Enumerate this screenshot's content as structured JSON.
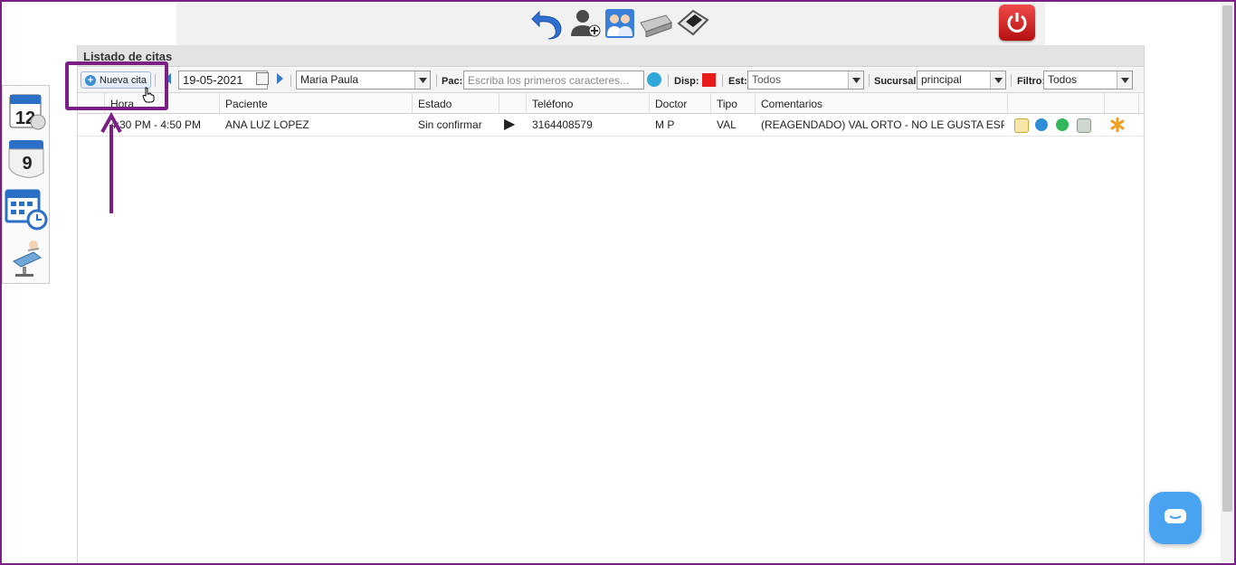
{
  "toolbar_top": {
    "icons": [
      "undo-icon",
      "add-user-icon",
      "users-icon",
      "printer-icon",
      "scanner-icon"
    ],
    "power_icon": "power-icon"
  },
  "sidebar": {
    "items": [
      {
        "name": "calendar-day-icon",
        "badge": "12"
      },
      {
        "name": "calendar-number-icon",
        "badge": "9"
      },
      {
        "name": "calendar-clock-icon"
      },
      {
        "name": "dental-chair-icon"
      }
    ]
  },
  "panel": {
    "title": "Listado de citas",
    "new_button": "Nueva cita",
    "date": "19-05-2021",
    "doctor": "Maria Paula",
    "pac_label": "Pac:",
    "pac_placeholder": "Escriba los primeros caracteres...",
    "disp_label": "Disp:",
    "disp_color": "#e81a1a",
    "est_label": "Est:",
    "est_value": "Todos",
    "sucursal_label": "Sucursal:",
    "sucursal_value": "principal",
    "filtro_label": "Filtro:",
    "filtro_value": "Todos"
  },
  "table": {
    "columns": [
      "Hora",
      "Paciente",
      "Estado",
      "",
      "Teléfono",
      "Doctor",
      "Tipo",
      "Comentarios"
    ],
    "rows": [
      {
        "hora": "4:30 PM - 4:50 PM",
        "paciente": "ANA LUZ LOPEZ",
        "estado": "Sin confirmar",
        "play": "▶",
        "telefono": "3164408579",
        "doctor": "M P",
        "tipo": "VAL",
        "comentarios": "(REAGENDADO) VAL ORTO - NO LE GUSTA ESP..."
      }
    ]
  },
  "accent": "#7b1f86",
  "chat_icon": "chat-icon"
}
